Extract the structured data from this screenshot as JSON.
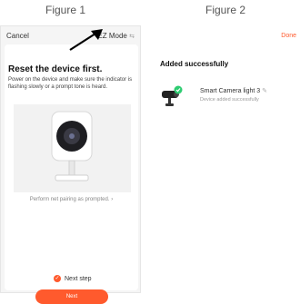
{
  "figure1": {
    "caption": "Figure 1",
    "cancel_label": "Cancel",
    "mode_label": "EZ Mode",
    "mode_icon": "swap-icon",
    "title": "Reset the device first.",
    "description": "Power on the device and make sure the indicator is flashing slowly or a prompt tone is heard.",
    "pairing_text": "Perform net pairing as prompted.",
    "next_step_label": "Next step",
    "next_button_label": "Next",
    "accent_color": "#ff5a2d"
  },
  "figure2": {
    "caption": "Figure 2",
    "done_label": "Done",
    "title": "Added successfully",
    "device": {
      "name": "Smart Camera light 3",
      "status": "Device added successfully"
    }
  }
}
